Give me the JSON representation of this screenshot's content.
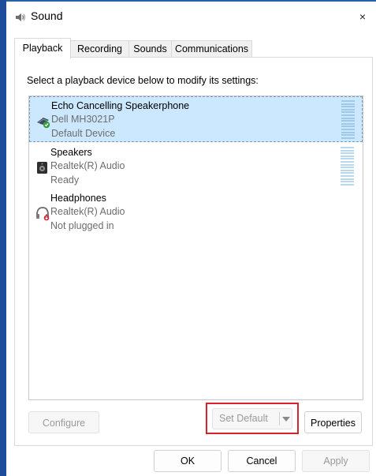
{
  "window": {
    "title": "Sound",
    "close_glyph": "×"
  },
  "tabs": [
    {
      "label": "Playback",
      "active": true
    },
    {
      "label": "Recording",
      "active": false
    },
    {
      "label": "Sounds",
      "active": false
    },
    {
      "label": "Communications",
      "active": false
    }
  ],
  "panel": {
    "instruction": "Select a playback device below to modify its settings:"
  },
  "devices": [
    {
      "name": "Echo Cancelling Speakerphone",
      "driver": "Dell MH3021P",
      "status": "Default Device",
      "icon": "speakerphone-icon",
      "selected": true
    },
    {
      "name": "Speakers",
      "driver": "Realtek(R) Audio",
      "status": "Ready",
      "icon": "speaker-icon",
      "selected": false
    },
    {
      "name": "Headphones",
      "driver": "Realtek(R) Audio",
      "status": "Not plugged in",
      "icon": "headphones-icon",
      "selected": false
    }
  ],
  "buttons": {
    "configure": "Configure",
    "set_default": "Set Default",
    "properties": "Properties"
  },
  "footer": {
    "ok": "OK",
    "cancel": "Cancel",
    "apply": "Apply"
  },
  "colors": {
    "selection": "#cce8ff",
    "highlight_border": "#d9202b",
    "accent": "#1e4c9a"
  }
}
